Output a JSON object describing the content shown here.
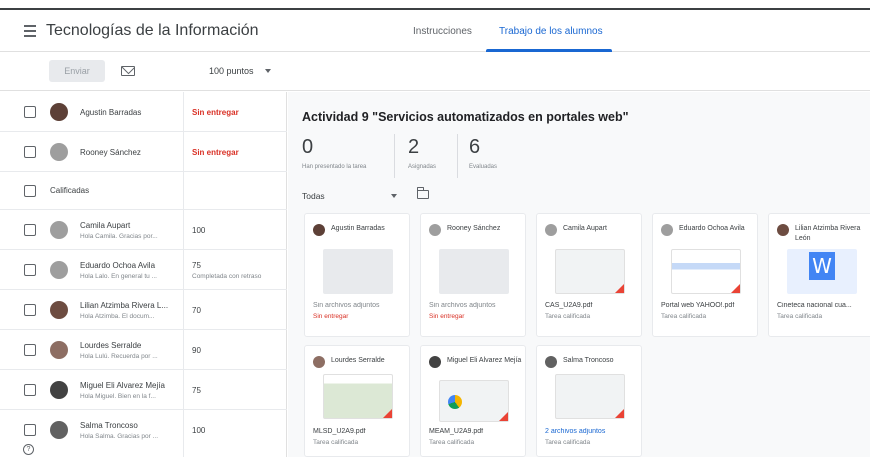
{
  "header": {
    "title": "Tecnologías de la Información",
    "tabs": [
      {
        "label": "Instrucciones"
      },
      {
        "label": "Trabajo de los alumnos"
      }
    ]
  },
  "toolbar": {
    "send_label": "Enviar",
    "points": "100 puntos"
  },
  "students": [
    {
      "name": "Agustin Barradas",
      "comment": "",
      "grade": "Sin entregar",
      "grade_sub": ""
    },
    {
      "name": "Rooney Sánchez",
      "comment": "",
      "grade": "Sin entregar",
      "grade_sub": ""
    },
    {
      "name": "Camila Aupart",
      "comment": "Hola Camila. Gracias por...",
      "grade": "100",
      "grade_sub": ""
    },
    {
      "name": "Eduardo Ochoa Avila",
      "comment": "Hola Lalo. En general tu ...",
      "grade": "75",
      "grade_sub": "Completada con retraso"
    },
    {
      "name": "Lilian Atzimba Rivera L...",
      "comment": "Hola Atzimba. El docum...",
      "grade": "70",
      "grade_sub": ""
    },
    {
      "name": "Lourdes Serralde",
      "comment": "Hola Lulú. Recuerda por ...",
      "grade": "90",
      "grade_sub": ""
    },
    {
      "name": "Miguel Eli Alvarez Mejía",
      "comment": "Hola Miguel. Bien en la f...",
      "grade": "75",
      "grade_sub": ""
    },
    {
      "name": "Salma Troncoso",
      "comment": "Hola Salma. Gracias por ...",
      "grade": "100",
      "grade_sub": ""
    }
  ],
  "section_graded": "Calificadas",
  "activity": {
    "title": "Actividad 9 \"Servicios automatizados en portales web\"",
    "stats": [
      {
        "value": "0",
        "label": "Han presentado la tarea"
      },
      {
        "value": "2",
        "label": "Asignadas"
      },
      {
        "value": "6",
        "label": "Evaluadas"
      }
    ],
    "filter": "Todas"
  },
  "cards": [
    {
      "name": "Agustin Barradas",
      "line1": "Sin archivos adjuntos",
      "line2": "Sin entregar"
    },
    {
      "name": "Rooney Sánchez",
      "line1": "Sin archivos adjuntos",
      "line2": "Sin entregar"
    },
    {
      "name": "Camila Aupart",
      "line1": "CAS_U2A9.pdf",
      "line2": "Tarea calificada"
    },
    {
      "name": "Eduardo Ochoa Avila",
      "line1": "Portal web YAHOO!.pdf",
      "line2": "Tarea calificada"
    },
    {
      "name": "Lilian Atzimba Rivera León",
      "line1": "Cineteca nacional cua...",
      "line2": "Tarea calificada"
    },
    {
      "name": "Lourdes Serralde",
      "line1": "MLSD_U2A9.pdf",
      "line2": "Tarea calificada"
    },
    {
      "name": "Miguel Eli Alvarez Mejía",
      "line1": "MEAM_U2A9.pdf",
      "line2": "Tarea calificada"
    },
    {
      "name": "Salma Troncoso",
      "line1": "2 archivos adjuntos",
      "line2": "Tarea calificada"
    }
  ],
  "colors": {
    "accent": "#1967d2",
    "missing": "#d93025",
    "pdf_corner": "#ea4335"
  }
}
